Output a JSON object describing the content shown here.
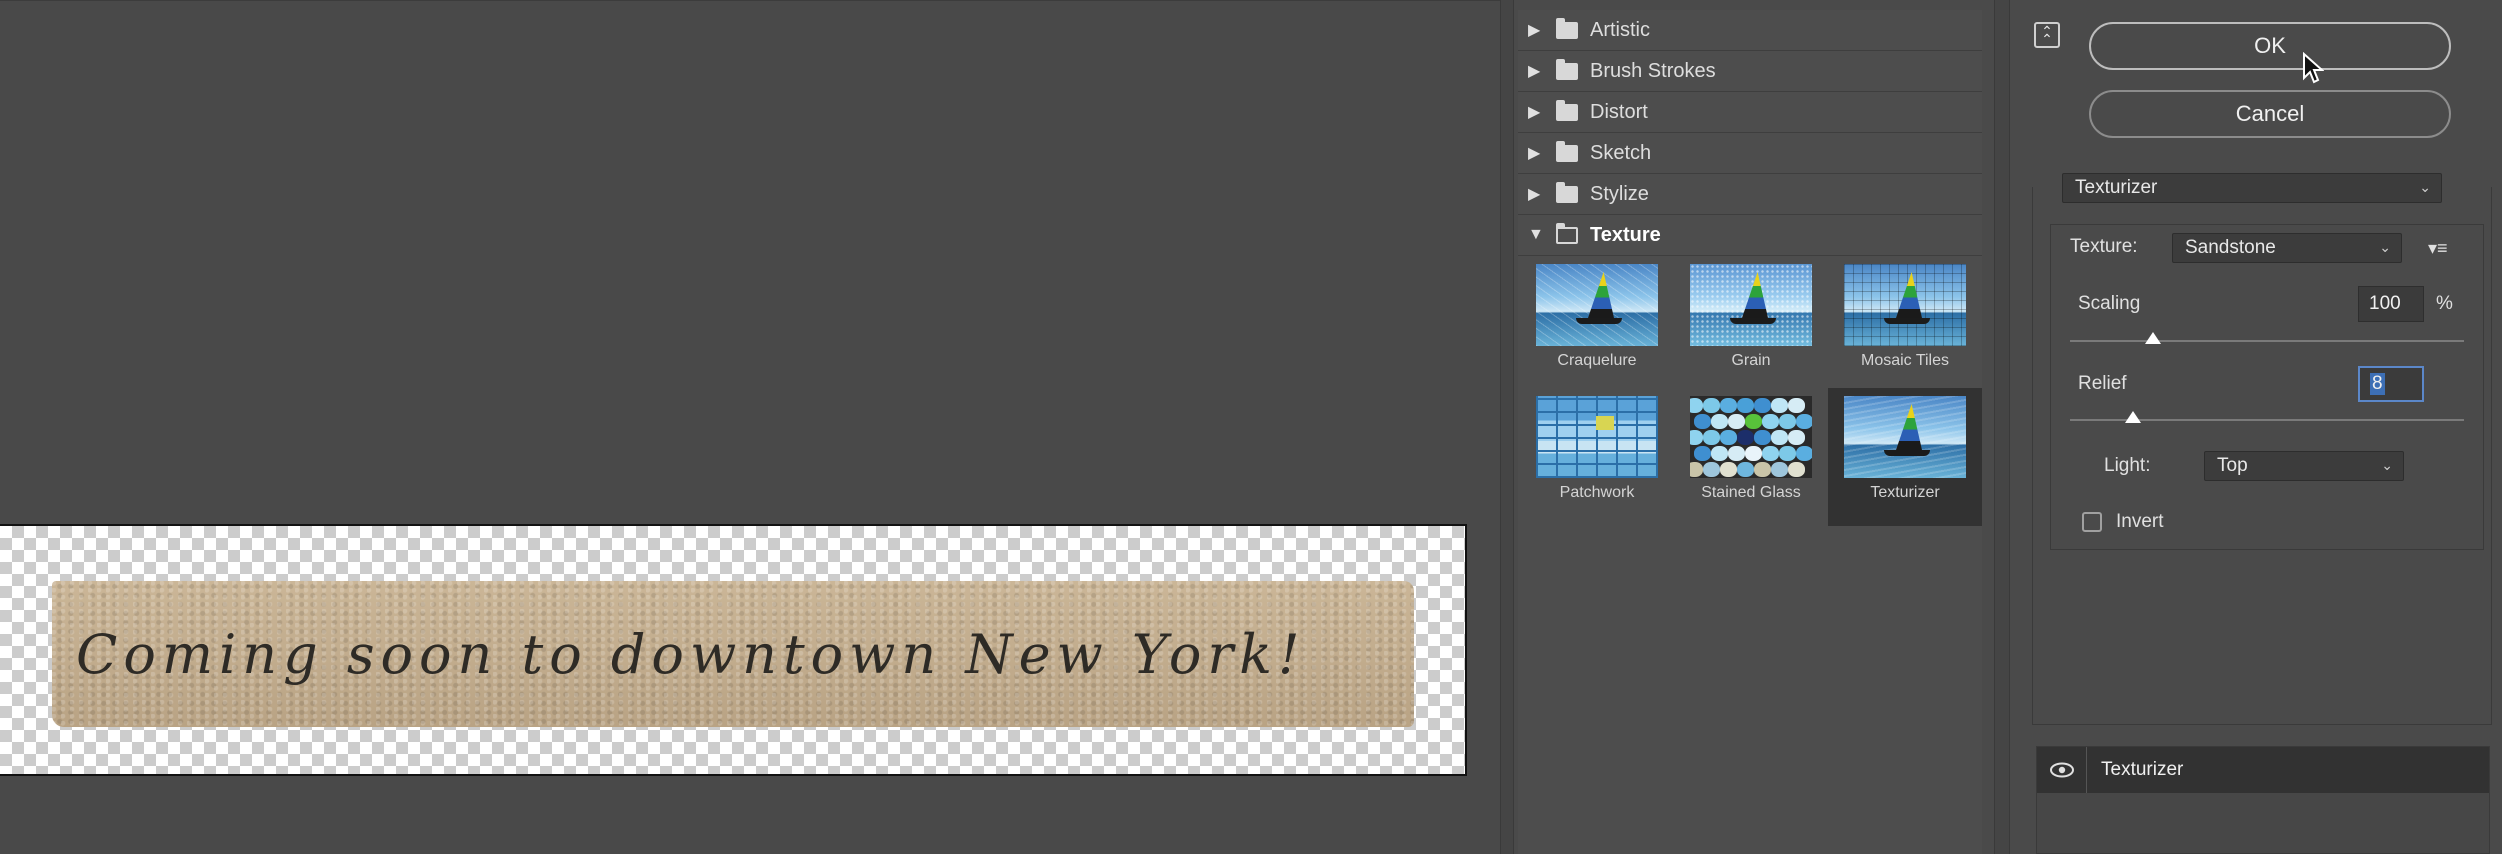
{
  "preview": {
    "canvas_text": "Coming soon to downtown New York!"
  },
  "gallery": {
    "categories": [
      {
        "label": "Artistic",
        "expanded": false
      },
      {
        "label": "Brush Strokes",
        "expanded": false
      },
      {
        "label": "Distort",
        "expanded": false
      },
      {
        "label": "Sketch",
        "expanded": false
      },
      {
        "label": "Stylize",
        "expanded": false
      },
      {
        "label": "Texture",
        "expanded": true
      }
    ],
    "thumbnails": [
      {
        "label": "Craquelure"
      },
      {
        "label": "Grain"
      },
      {
        "label": "Mosaic Tiles"
      },
      {
        "label": "Patchwork"
      },
      {
        "label": "Stained Glass"
      },
      {
        "label": "Texturizer",
        "selected": true
      }
    ]
  },
  "settings": {
    "ok_label": "OK",
    "cancel_label": "Cancel",
    "filter_name": "Texturizer",
    "texture_label": "Texture:",
    "texture_value": "Sandstone",
    "scaling_label": "Scaling",
    "scaling_value": "100",
    "scaling_unit": "%",
    "scaling_level": 0.21,
    "relief_label": "Relief",
    "relief_value": "8",
    "relief_level": 0.16,
    "light_label": "Light:",
    "light_value": "Top",
    "invert_label": "Invert",
    "invert_checked": false
  },
  "layers": {
    "effect_name": "Texturizer"
  },
  "colors": {
    "background": "#4a4a4a",
    "selected_thumb_bg": "#323232",
    "focus_outline": "#5b87c9"
  }
}
